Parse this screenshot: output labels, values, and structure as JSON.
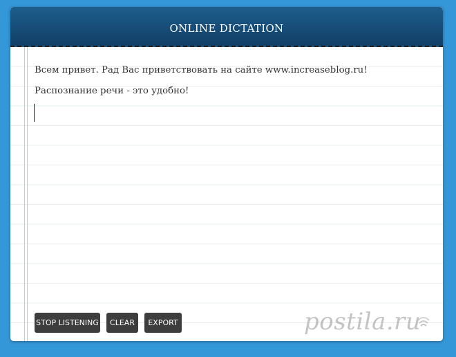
{
  "header": {
    "title": "ONLINE DICTATION"
  },
  "editor": {
    "lines": [
      "Всем привет. Рад Вас приветствовать на сайте www.increaseblog.ru!",
      "Распознание речи - это удобно!"
    ]
  },
  "toolbar": {
    "stop_label": "STOP LISTENING",
    "clear_label": "CLEAR",
    "export_label": "EXPORT"
  },
  "watermark": {
    "text": "postila.ru"
  },
  "colors": {
    "background": "#3497d8",
    "header": "#1a5482",
    "button": "#3d3d3d"
  }
}
